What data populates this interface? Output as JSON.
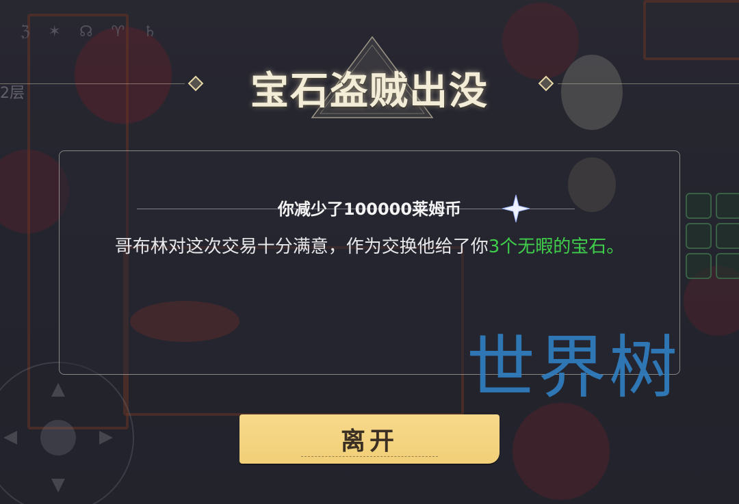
{
  "background": {
    "floor_label": "2层",
    "top_glyphs": "ℨ ✶ ☊ ♈ ♄"
  },
  "event": {
    "title": "宝石盗贼出没",
    "subtitle": "你减少了100000莱姆币",
    "message_main": "哥布林对这次交易十分满意，作为交换他给了你",
    "message_highlight": "3个无暇的宝石",
    "message_end": "。"
  },
  "watermark": "世界树",
  "leave_button": {
    "label": "离开"
  },
  "colors": {
    "highlight_green": "#3fcf4b",
    "button_gold": "#f4d47f",
    "title_cream": "#f3ecd6",
    "watermark_blue": "#2f7fc0"
  }
}
